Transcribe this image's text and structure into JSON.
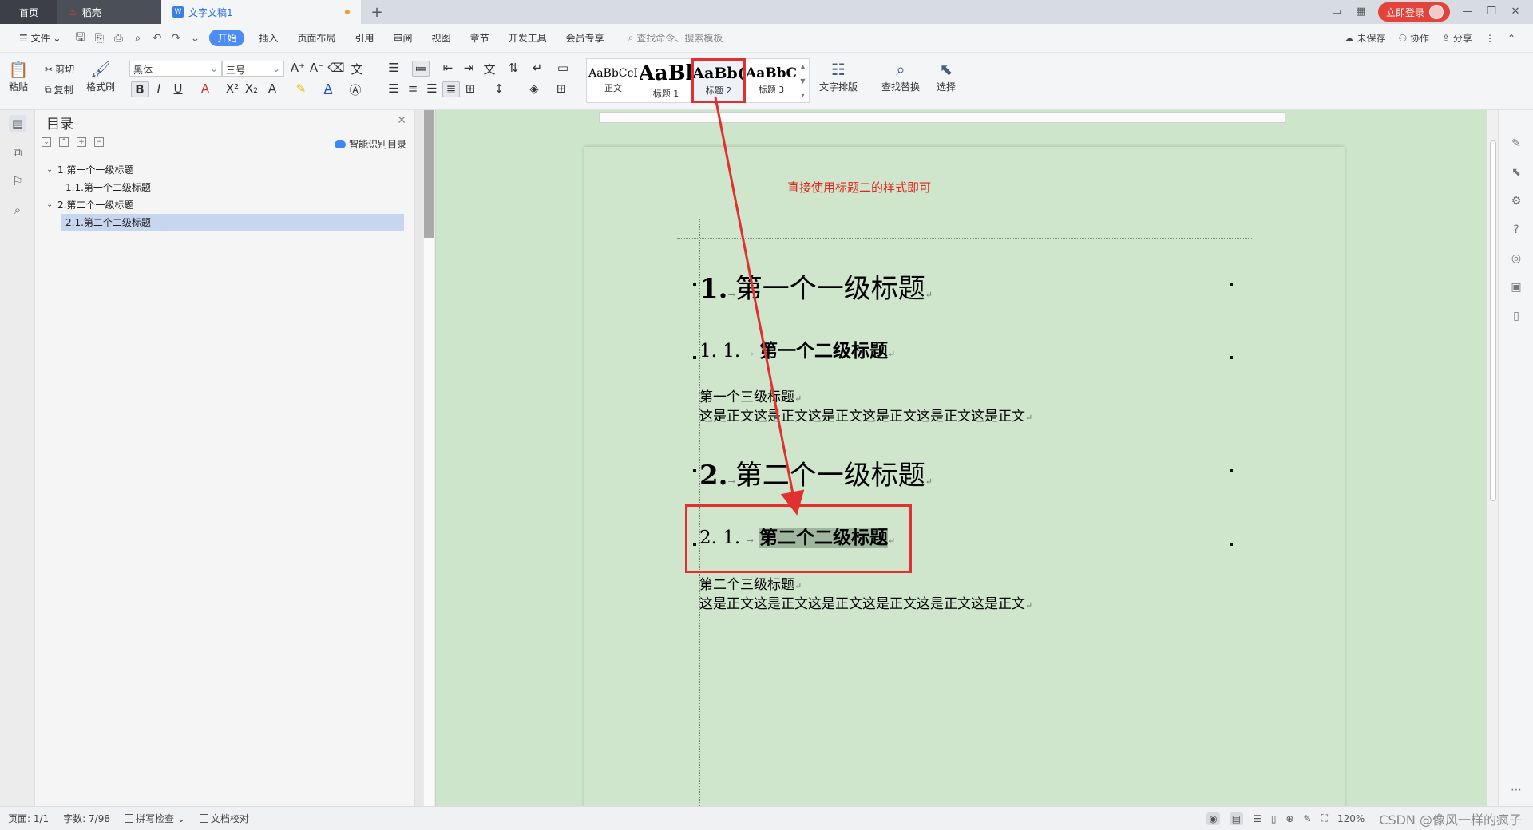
{
  "tabs": {
    "home": "首页",
    "daoke": "稻壳",
    "doc": "文字文稿1",
    "login": "立即登录"
  },
  "menu": {
    "file": "文件",
    "items": [
      "开始",
      "插入",
      "页面布局",
      "引用",
      "审阅",
      "视图",
      "章节",
      "开发工具",
      "会员专享"
    ],
    "search": "查找命令、搜索模板",
    "unsaved": "未保存",
    "collab": "协作",
    "share": "分享"
  },
  "ribbon": {
    "paste": "粘贴",
    "cut": "剪切",
    "copy": "复制",
    "format_painter": "格式刷",
    "font": "黑体",
    "size": "三号",
    "styles": [
      {
        "preview": "AaBbCcI",
        "label": "正文"
      },
      {
        "preview": "AaBl",
        "label": "标题 1"
      },
      {
        "preview": "AaBb(",
        "label": "标题 2"
      },
      {
        "preview": "AaBbC",
        "label": "标题 3"
      }
    ],
    "text_layout": "文字排版",
    "find_replace": "查找替换",
    "select": "选择"
  },
  "nav": {
    "title": "目录",
    "smart": "智能识别目录",
    "toc": [
      {
        "text": "1.第一个一级标题",
        "level": 1
      },
      {
        "text": "1.1.第一个二级标题",
        "level": 2
      },
      {
        "text": "2.第二个一级标题",
        "level": 1
      },
      {
        "text": "2.1.第二个二级标题",
        "level": 2
      }
    ]
  },
  "document": {
    "note": "直接使用标题二的样式即可",
    "h1a_num": "1.",
    "h1a_text": "第一个一级标题",
    "h2a_num": "1. 1.",
    "h2a_text": "第一个二级标题",
    "h3a": "第一个三级标题",
    "body_a": "这是正文这是正文这是正文这是正文这是正文这是正文",
    "h1b_num": "2.",
    "h1b_text": "第二个一级标题",
    "h2b_num": "2. 1.",
    "h2b_text": "第二个二级标题",
    "h3b": "第二个三级标题",
    "body_b": "这是正文这是正文这是正文这是正文这是正文这是正文"
  },
  "status": {
    "page": "页面: 1/1",
    "words": "字数: 7/98",
    "spell": "拼写检查",
    "proof": "文档校对",
    "zoom": "120%",
    "watermark": "CSDN @像风一样的疯子"
  },
  "colors": {
    "accent": "#4c8cf5",
    "annotation_red": "#e0302f",
    "page_green": "#cde6cb"
  }
}
